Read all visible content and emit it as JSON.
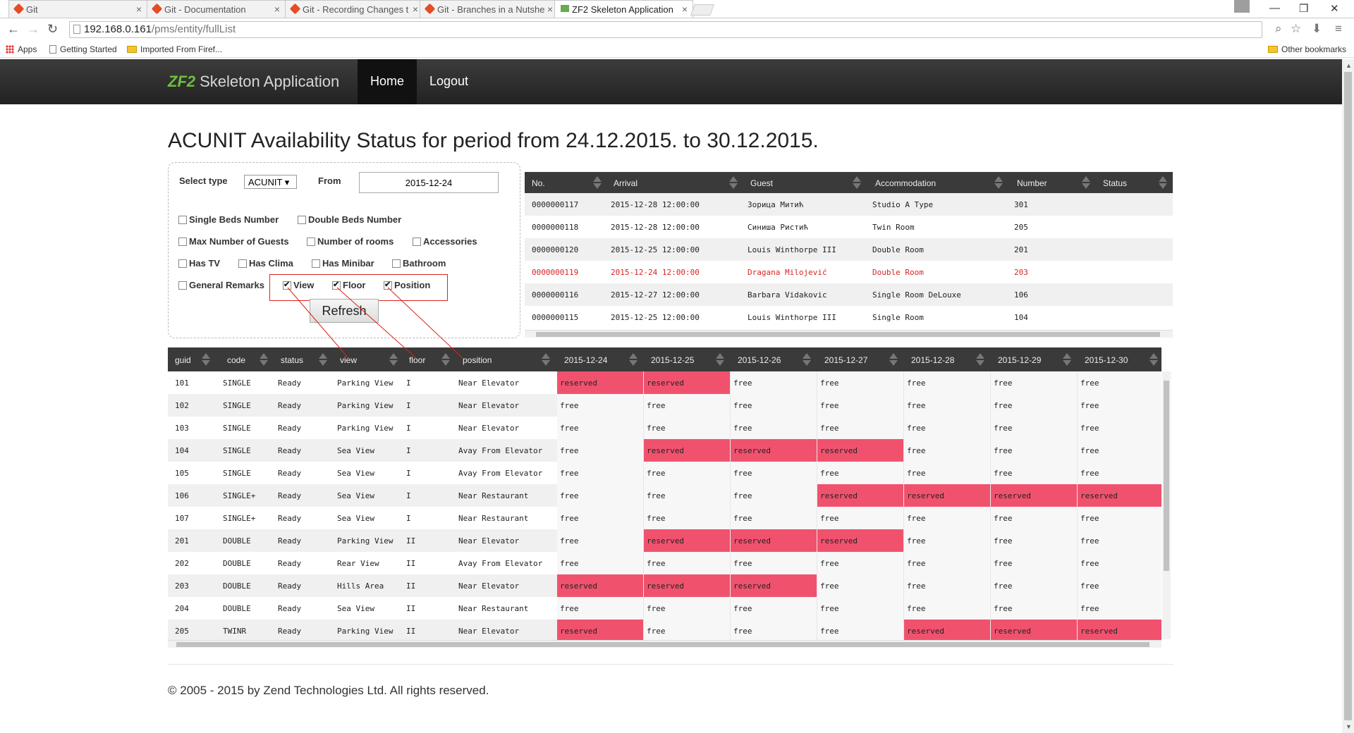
{
  "browser": {
    "tabs": [
      {
        "title": "Git"
      },
      {
        "title": "Git - Documentation"
      },
      {
        "title": "Git - Recording Changes t"
      },
      {
        "title": "Git - Branches in a Nutshe"
      },
      {
        "title": "ZF2 Skeleton Application"
      }
    ],
    "url_host": "192.168.0.161",
    "url_path": "/pms/entity/fullList",
    "bookmarks": {
      "apps": "Apps",
      "getting_started": "Getting Started",
      "imported": "Imported From Firef...",
      "other": "Other bookmarks"
    }
  },
  "navbar": {
    "brand_logo": "ZF2",
    "brand": "Skeleton Application",
    "home": "Home",
    "logout": "Logout"
  },
  "page_title": "ACUNIT Availability Status for period from 24.12.2015. to 30.12.2015.",
  "filter": {
    "select_type_label": "Select type",
    "select_type_value": "ACUNIT ▾",
    "from_label": "From",
    "from_value": "2015-12-24",
    "checkboxes": {
      "single_beds": "Single Beds Number",
      "double_beds": "Double Beds Number",
      "max_guests": "Max Number of Guests",
      "num_rooms": "Number of rooms",
      "accessories": "Accessories",
      "has_tv": "Has TV",
      "has_clima": "Has Clima",
      "has_minibar": "Has Minibar",
      "bathroom": "Bathroom",
      "general_remarks": "General Remarks",
      "view": "View",
      "floor": "Floor",
      "position": "Position"
    },
    "refresh": "Refresh"
  },
  "reservations": {
    "headers": [
      "No.",
      "Arrival",
      "Guest",
      "Accommodation",
      "Number",
      "Status"
    ],
    "rows": [
      {
        "no": "0000000117",
        "arrival": "2015-12-28 12:00:00",
        "guest": "Зорица Митић",
        "accommodation": "Studio A Type",
        "number": "301",
        "status": ""
      },
      {
        "no": "0000000118",
        "arrival": "2015-12-28 12:00:00",
        "guest": "Синиша Ристић",
        "accommodation": "Twin Room",
        "number": "205",
        "status": ""
      },
      {
        "no": "0000000120",
        "arrival": "2015-12-25 12:00:00",
        "guest": "Louis Winthorpe III",
        "accommodation": "Double Room",
        "number": "201",
        "status": ""
      },
      {
        "no": "0000000119",
        "arrival": "2015-12-24 12:00:00",
        "guest": "Dragana Milojević",
        "accommodation": "Double Room",
        "number": "203",
        "status": ""
      },
      {
        "no": "0000000116",
        "arrival": "2015-12-27 12:00:00",
        "guest": "Barbara Vidakovic",
        "accommodation": "Single Room DeLouxe",
        "number": "106",
        "status": ""
      },
      {
        "no": "0000000115",
        "arrival": "2015-12-25 12:00:00",
        "guest": "Louis Winthorpe III",
        "accommodation": "Single Room",
        "number": "104",
        "status": ""
      }
    ]
  },
  "availability": {
    "headers": [
      "guid",
      "code",
      "status",
      "view",
      "floor",
      "position"
    ],
    "dates": [
      "2015-12-24",
      "2015-12-25",
      "2015-12-26",
      "2015-12-27",
      "2015-12-28",
      "2015-12-29",
      "2015-12-30"
    ],
    "rows": [
      {
        "guid": "101",
        "code": "SINGLE",
        "status": "Ready",
        "view": "Parking View",
        "floor": "I",
        "position": "Near Elevator",
        "days": [
          "reserved",
          "reserved",
          "free",
          "free",
          "free",
          "free",
          "free"
        ]
      },
      {
        "guid": "102",
        "code": "SINGLE",
        "status": "Ready",
        "view": "Parking View",
        "floor": "I",
        "position": "Near Elevator",
        "days": [
          "free",
          "free",
          "free",
          "free",
          "free",
          "free",
          "free"
        ]
      },
      {
        "guid": "103",
        "code": "SINGLE",
        "status": "Ready",
        "view": "Parking View",
        "floor": "I",
        "position": "Near Elevator",
        "days": [
          "free",
          "free",
          "free",
          "free",
          "free",
          "free",
          "free"
        ]
      },
      {
        "guid": "104",
        "code": "SINGLE",
        "status": "Ready",
        "view": "Sea View",
        "floor": "I",
        "position": "Avay From Elevator",
        "days": [
          "free",
          "reserved",
          "reserved",
          "reserved",
          "free",
          "free",
          "free"
        ]
      },
      {
        "guid": "105",
        "code": "SINGLE",
        "status": "Ready",
        "view": "Sea View",
        "floor": "I",
        "position": "Avay From Elevator",
        "days": [
          "free",
          "free",
          "free",
          "free",
          "free",
          "free",
          "free"
        ]
      },
      {
        "guid": "106",
        "code": "SINGLE+",
        "status": "Ready",
        "view": "Sea View",
        "floor": "I",
        "position": "Near Restaurant",
        "days": [
          "free",
          "free",
          "free",
          "reserved",
          "reserved",
          "reserved",
          "reserved"
        ]
      },
      {
        "guid": "107",
        "code": "SINGLE+",
        "status": "Ready",
        "view": "Sea View",
        "floor": "I",
        "position": "Near Restaurant",
        "days": [
          "free",
          "free",
          "free",
          "free",
          "free",
          "free",
          "free"
        ]
      },
      {
        "guid": "201",
        "code": "DOUBLE",
        "status": "Ready",
        "view": "Parking View",
        "floor": "II",
        "position": "Near Elevator",
        "days": [
          "free",
          "reserved",
          "reserved",
          "reserved",
          "free",
          "free",
          "free"
        ]
      },
      {
        "guid": "202",
        "code": "DOUBLE",
        "status": "Ready",
        "view": "Rear View",
        "floor": "II",
        "position": "Avay From Elevator",
        "days": [
          "free",
          "free",
          "free",
          "free",
          "free",
          "free",
          "free"
        ]
      },
      {
        "guid": "203",
        "code": "DOUBLE",
        "status": "Ready",
        "view": "Hills Area",
        "floor": "II",
        "position": "Near Elevator",
        "days": [
          "reserved",
          "reserved",
          "reserved",
          "free",
          "free",
          "free",
          "free"
        ]
      },
      {
        "guid": "204",
        "code": "DOUBLE",
        "status": "Ready",
        "view": "Sea View",
        "floor": "II",
        "position": "Near Restaurant",
        "days": [
          "free",
          "free",
          "free",
          "free",
          "free",
          "free",
          "free"
        ]
      },
      {
        "guid": "205",
        "code": "TWINR",
        "status": "Ready",
        "view": "Parking View",
        "floor": "II",
        "position": "Near Elevator",
        "days": [
          "reserved",
          "free",
          "free",
          "free",
          "reserved",
          "reserved",
          "reserved"
        ]
      }
    ]
  },
  "colors": {
    "reserved": "#f0526e",
    "free": "#f7f7f7",
    "alert_text": "#d22222",
    "annotation": "#d9241b"
  },
  "footer": "© 2005 - 2015 by Zend Technologies Ltd. All rights reserved."
}
